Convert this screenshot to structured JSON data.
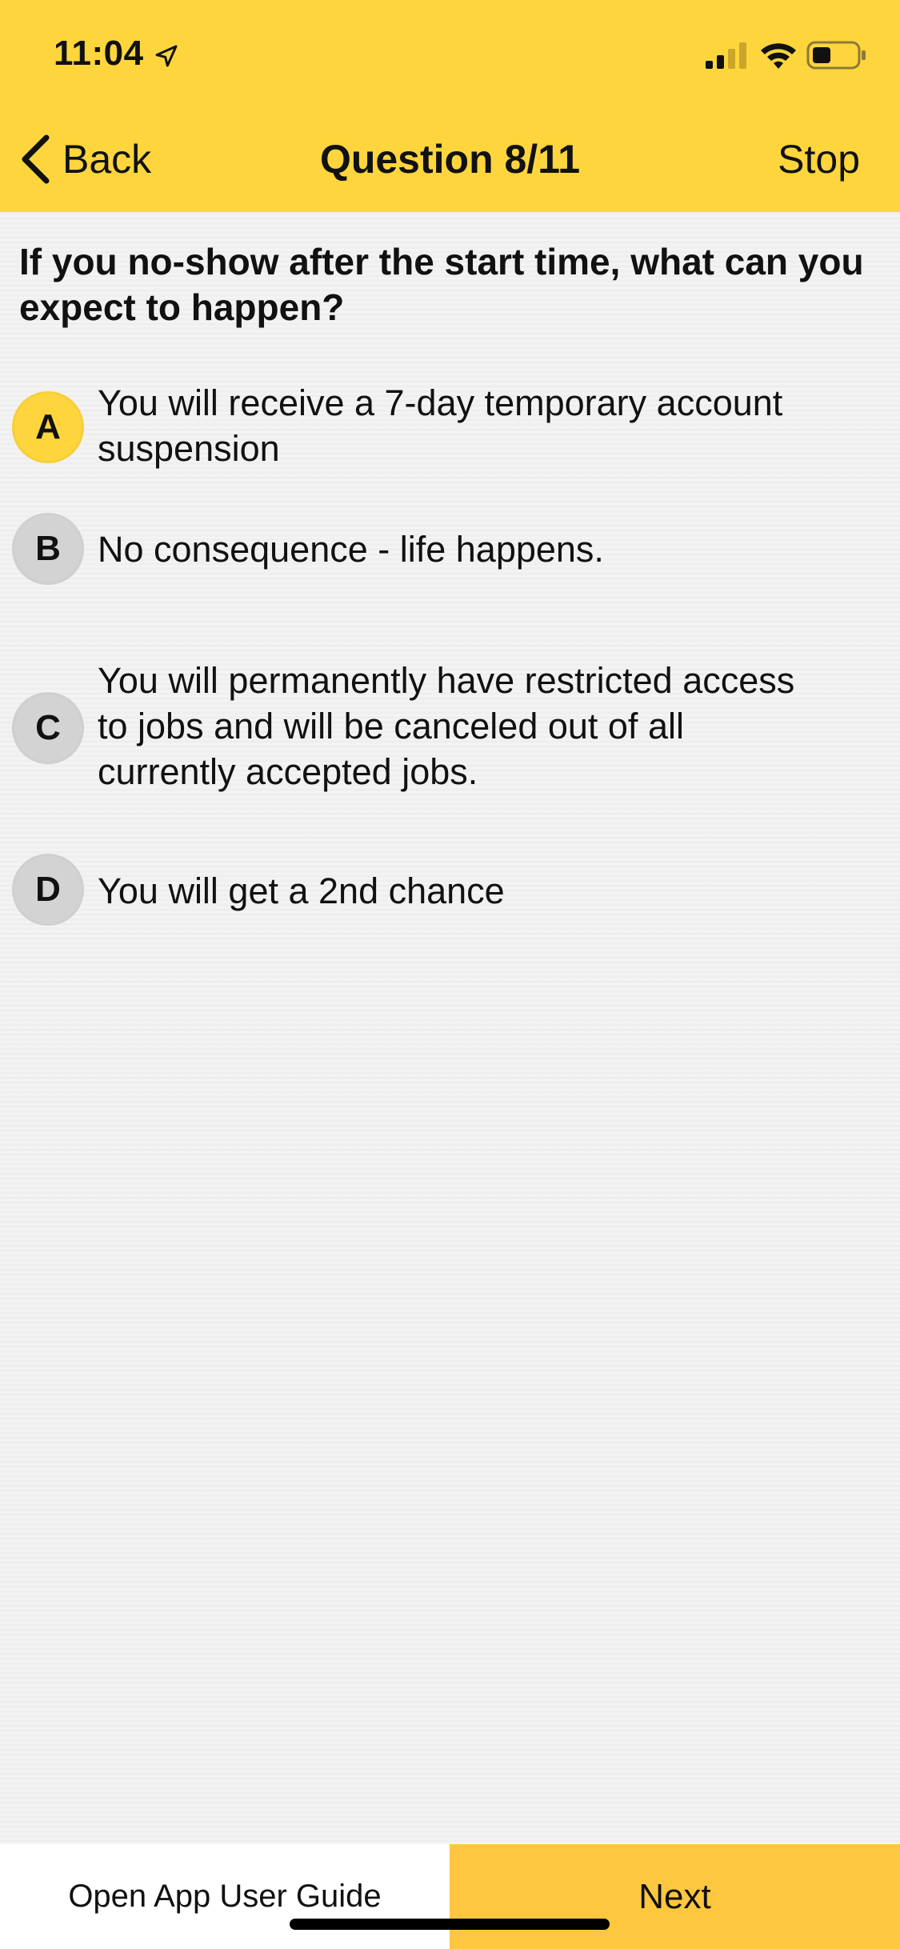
{
  "status_bar": {
    "time": "11:04"
  },
  "nav": {
    "back_label": "Back",
    "title": "Question 8/11",
    "stop_label": "Stop"
  },
  "question": {
    "text": "If you no-show after the start time, what can you expect to happen?"
  },
  "options": [
    {
      "letter": "A",
      "text": "You will receive a 7-day temporary account suspension",
      "selected": true
    },
    {
      "letter": "B",
      "text": "No consequence - life happens.",
      "selected": false
    },
    {
      "letter": "C",
      "text": "You will permanently have restricted access to jobs and will be canceled out of all currently accepted jobs.",
      "selected": false
    },
    {
      "letter": "D",
      "text": "You will get a 2nd chance",
      "selected": false
    }
  ],
  "footer": {
    "guide_label": "Open App User Guide",
    "next_label": "Next"
  },
  "colors": {
    "header_yellow": "#fed53c",
    "next_yellow": "#fec73f",
    "selected_option": "#fed53c",
    "unselected_option": "#d3d3d3",
    "background": "#efefef"
  }
}
